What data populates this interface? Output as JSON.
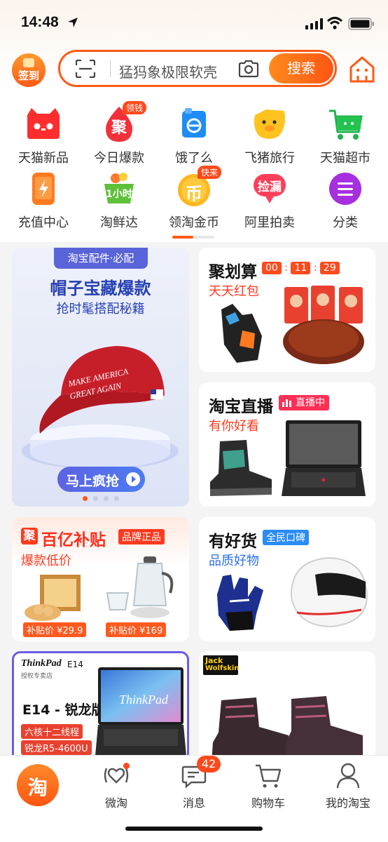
{
  "status_bar": {
    "time": "14:48"
  },
  "search": {
    "signin_label": "签到",
    "query": "猛犸象极限软壳",
    "button": "搜索"
  },
  "grid": [
    {
      "label": "天猫新品"
    },
    {
      "label": "今日爆款",
      "icon_text": "聚",
      "badge": "领钱"
    },
    {
      "label": "饿了么"
    },
    {
      "label": "飞猪旅行"
    },
    {
      "label": "天猫超市"
    },
    {
      "label": "充值中心"
    },
    {
      "label": "淘鲜达",
      "icon_text": "1小时"
    },
    {
      "label": "领淘金币",
      "icon_text": "币",
      "badge": "快来"
    },
    {
      "label": "阿里拍卖",
      "icon_text": "捡漏"
    },
    {
      "label": "分类"
    }
  ],
  "banner": {
    "tag": "淘宝配件·必配",
    "title": "帽子宝藏爆款",
    "subtitle": "抢时髦搭配秘籍",
    "cap_text_1": "MAKE AMERICA",
    "cap_text_2": "GREAT AGAIN",
    "button": "马上疯抢"
  },
  "juhuasuan": {
    "title": "聚划算",
    "countdown": [
      "00",
      "11",
      "29"
    ],
    "subtitle": "天天红包"
  },
  "live": {
    "title": "淘宝直播",
    "badge": "直播中",
    "subtitle": "有你好看"
  },
  "subsidy": {
    "logo_char": "聚",
    "title": "百亿补贴",
    "tag": "品牌正品",
    "subtitle": "爆款低价",
    "price1": "补贴价 ¥29.9",
    "price2": "补贴价 ¥169"
  },
  "goods": {
    "title": "有好货",
    "tag": "全民口碑",
    "subtitle": "品质好物"
  },
  "thinkpad": {
    "brand": "ThinkPad",
    "model_small": "E14",
    "store": "授权专卖店",
    "model": "E14 - 锐龙版",
    "tag1": "六核十二线程",
    "tag2": "锐龙R5-4600U",
    "screen_logo": "ThinkPad"
  },
  "jackwolfskin": {
    "brand_1": "Jack",
    "brand_2": "Wolfskin"
  },
  "tabbar": {
    "home_char": "淘",
    "items": [
      {
        "label": "微淘"
      },
      {
        "label": "消息",
        "badge": "42"
      },
      {
        "label": "购物车"
      },
      {
        "label": "我的淘宝"
      }
    ]
  },
  "colors": {
    "accent": "#ff5a14",
    "red": "#ff2d2d",
    "blue": "#2b6fe6"
  }
}
